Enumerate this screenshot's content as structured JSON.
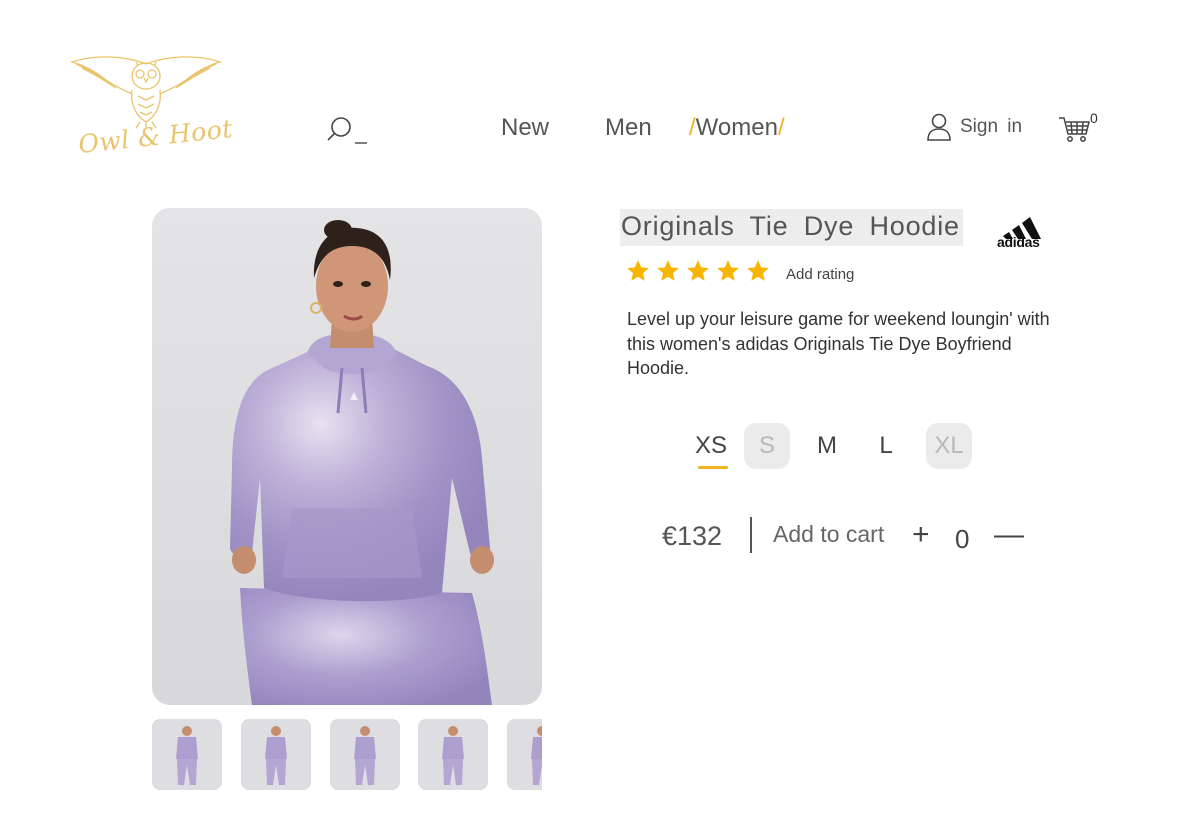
{
  "header": {
    "logo_text": "Owl & Hoot",
    "nav": [
      {
        "label": "New"
      },
      {
        "label": "Men"
      },
      {
        "label": "Women"
      }
    ],
    "signin_label": "Sign in",
    "cart_count": "0"
  },
  "product": {
    "title": "Originals Tie Dye Hoodie",
    "brand": "adidas",
    "add_rating_label": "Add rating",
    "rating": 5,
    "description": "Level up your leisure game for weekend loungin' with this women's adidas Originals Tie Dye Boyfriend Hoodie.",
    "sizes": [
      {
        "label": "XS",
        "state": "selected"
      },
      {
        "label": "S",
        "state": "unavailable"
      },
      {
        "label": "M",
        "state": "available"
      },
      {
        "label": "L",
        "state": "available"
      },
      {
        "label": "XL",
        "state": "unavailable"
      }
    ],
    "price": "€132",
    "add_to_cart_label": "Add to cart",
    "plus_label": "+",
    "quantity": "0",
    "minus_label": "—"
  },
  "colors": {
    "accent": "#f0b323",
    "logo_gold": "#e9c46a",
    "hoodie_lilac": "#a597c7"
  },
  "icons": [
    "owl-logo-icon",
    "search-icon",
    "user-icon",
    "cart-icon",
    "star-icon",
    "adidas-logo-icon"
  ]
}
